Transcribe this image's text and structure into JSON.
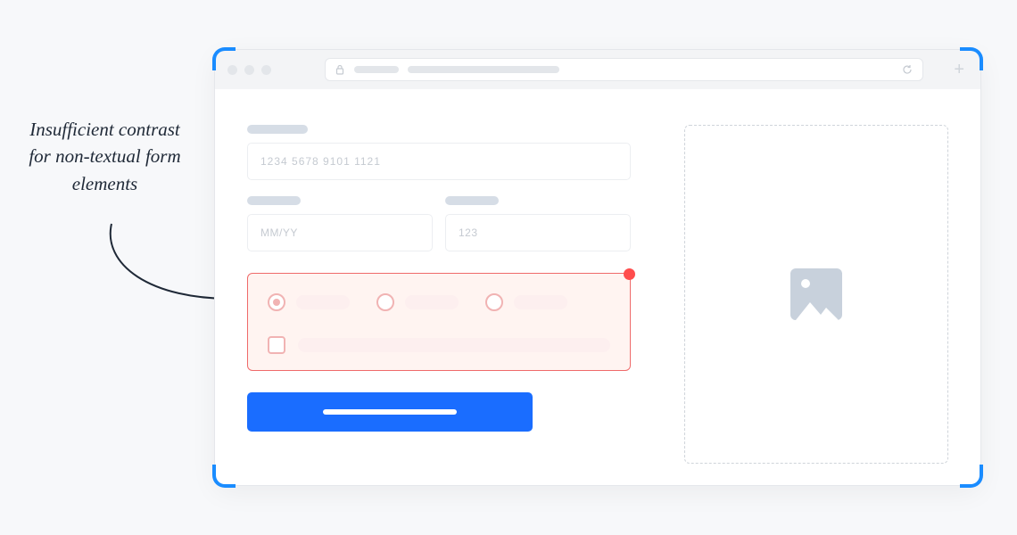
{
  "annotation": {
    "text": "Insufficient contrast for non-textual form elements"
  },
  "form": {
    "card_placeholder": "1234  5678  9101  1121",
    "expiry_placeholder": "MM/YY",
    "cvc_placeholder": "123"
  },
  "options": {
    "radio_selected_index": 0,
    "radio_count": 3,
    "checkbox_checked": false
  },
  "colors": {
    "accent": "#1a6dff",
    "error_border": "#ef6a6a",
    "error_dot": "#ff4d4d"
  }
}
